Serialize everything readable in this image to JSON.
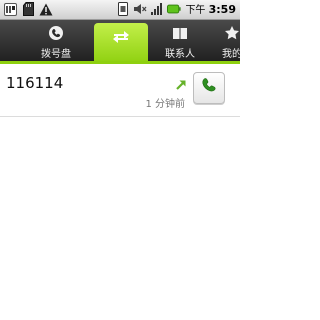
{
  "status_bar": {
    "time_prefix": "下午",
    "time": "3:59"
  },
  "tabs": [
    {
      "label": "拨号盘",
      "icon": "dialer-icon"
    },
    {
      "label": "",
      "icon": "call-log-icon"
    },
    {
      "label": "联系人",
      "icon": "contacts-icon"
    },
    {
      "label": "我的",
      "icon": "star-icon"
    }
  ],
  "call_log": [
    {
      "number": "116114",
      "time": "1 分钟前",
      "type": "outgoing"
    }
  ],
  "colors": {
    "accent": "#8ed00f",
    "call_type": "#66b22a",
    "phone_icon": "#2f8f22"
  }
}
